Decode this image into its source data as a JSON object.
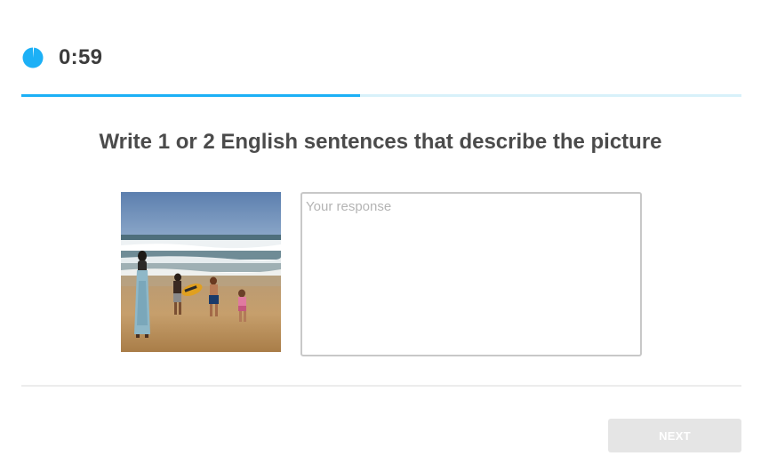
{
  "timer": {
    "icon": "timer-pie-icon",
    "value": "0:59",
    "color": "#1cb0f6"
  },
  "progress": {
    "fraction": 0.47,
    "fill_color": "#1cb0f6",
    "track_color": "#d8f1fa"
  },
  "prompt": {
    "text": "Write 1 or 2 English sentences that describe the picture"
  },
  "picture": {
    "subject": "woman-and-children-walking-on-beach"
  },
  "response": {
    "placeholder": "Your response",
    "value": ""
  },
  "footer": {
    "next_label": "NEXT"
  }
}
